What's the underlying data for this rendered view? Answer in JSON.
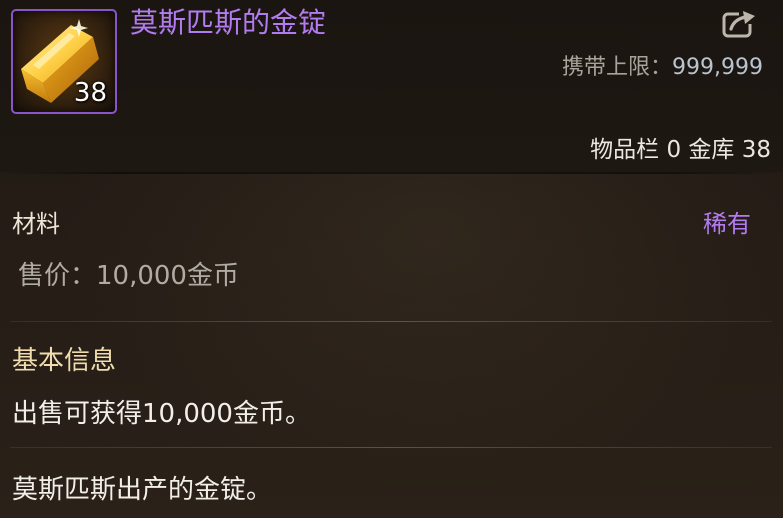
{
  "item": {
    "name": "莫斯匹斯的金锭",
    "quantity": "38",
    "icon": "gold-ingot-icon"
  },
  "header": {
    "share_icon": "share-export-icon",
    "carry_label": "携带上限：",
    "carry_value": "999,999",
    "storage_text": "物品栏 0 金库 38"
  },
  "details": {
    "type": "材料",
    "rarity": "稀有",
    "price": "售价：10,000金币"
  },
  "info": {
    "title": "基本信息",
    "sell_text": "出售可获得10,000金币。",
    "description": "莫斯匹斯出产的金锭。"
  },
  "colors": {
    "rarity_purple": "#b27cf0",
    "section_gold": "#f0dcae",
    "background": "#241d16"
  }
}
